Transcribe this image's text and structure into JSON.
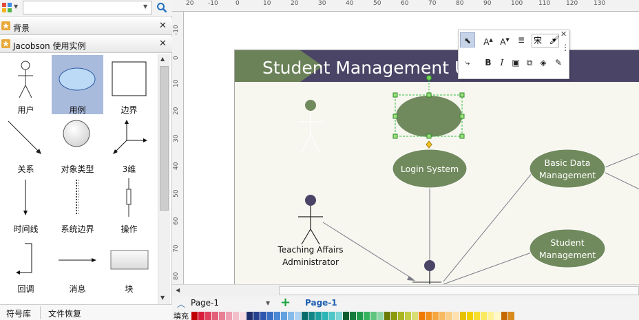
{
  "left_panel": {
    "search": {
      "value": ""
    },
    "libraries": [
      {
        "title": "背景"
      },
      {
        "title": "Jacobson 使用实例"
      }
    ],
    "shapes": [
      {
        "label": "用户",
        "icon": "actor-icon"
      },
      {
        "label": "用例",
        "icon": "use-case-icon",
        "selected": true
      },
      {
        "label": "边界",
        "icon": "boundary-icon"
      },
      {
        "label": "关系",
        "icon": "relation-icon"
      },
      {
        "label": "对象类型",
        "icon": "object-type-icon"
      },
      {
        "label": "3维",
        "icon": "3d-icon"
      },
      {
        "label": "时间线",
        "icon": "timeline-icon"
      },
      {
        "label": "系统边界",
        "icon": "system-boundary-icon"
      },
      {
        "label": "操作",
        "icon": "operation-icon"
      },
      {
        "label": "回调",
        "icon": "callback-icon"
      },
      {
        "label": "消息",
        "icon": "message-icon"
      },
      {
        "label": "块",
        "icon": "block-icon"
      }
    ],
    "bottom_tabs": [
      "符号库",
      "文件恢复"
    ]
  },
  "ruler": {
    "top": [
      "20",
      "-10",
      "0",
      "10",
      "20",
      "30",
      "40",
      "50",
      "60",
      "70",
      "80",
      "90",
      "100",
      "110",
      "120",
      "130"
    ],
    "left": [
      "-10",
      "0",
      "10",
      "20",
      "30",
      "40",
      "50",
      "60",
      "70",
      "80"
    ]
  },
  "diagram": {
    "title": "Student Management Use Case",
    "header_color": "#4a4466",
    "accent_color": "#6b8259",
    "use_cases": [
      {
        "id": "selected",
        "label": ""
      },
      {
        "id": "login",
        "label": "Login System"
      },
      {
        "id": "basic",
        "label": "Basic Data Management"
      },
      {
        "id": "student",
        "label": "Student Management"
      }
    ],
    "actors": [
      {
        "id": "actor1",
        "label": ""
      },
      {
        "id": "actor2",
        "label": "Teaching Affairs Administrator"
      }
    ]
  },
  "float_toolbar": {
    "font_value": "宋"
  },
  "page_bar": {
    "current_page": "Page-1",
    "tab_label": "Page-1"
  },
  "color_bar": {
    "label": "填充",
    "swatches": [
      "#c00000",
      "#d81e3c",
      "#e0405e",
      "#e3607a",
      "#e87f95",
      "#ee9fb0",
      "#f2bfca",
      "#f7dde3",
      "#1f2e6b",
      "#25408f",
      "#2f56ad",
      "#3a6ec4",
      "#4a87d4",
      "#62a1e0",
      "#86bbe9",
      "#aed3f2",
      "#0a6b6b",
      "#138585",
      "#1b9f9f",
      "#2cb5b5",
      "#51c6c6",
      "#7fd6d6",
      "#0d5c2e",
      "#157a3c",
      "#1f9a4c",
      "#34b35f",
      "#5fc57e",
      "#8fd6a4",
      "#6b7a00",
      "#8c9a0a",
      "#a9b620",
      "#c3cc42",
      "#d8de74",
      "#ee7a00",
      "#f28f1b",
      "#f5a53d",
      "#f8ba61",
      "#fbcf89",
      "#ffe0b0",
      "#e6c200",
      "#f0d000",
      "#f7df2f",
      "#fbe962",
      "#fdf295",
      "#fff8c7",
      "#c56a00",
      "#d98a1c"
    ]
  }
}
